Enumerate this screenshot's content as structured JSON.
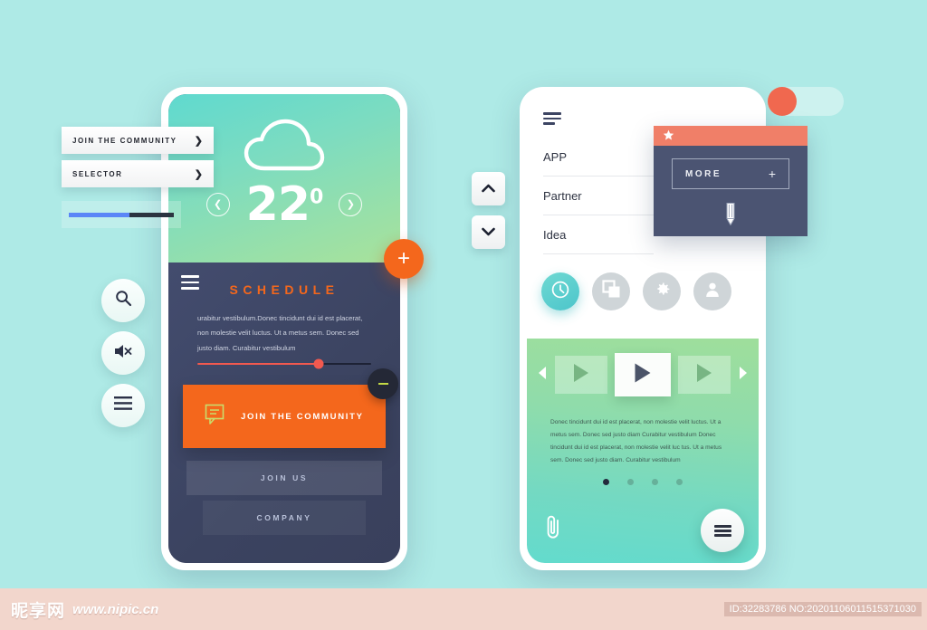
{
  "background": {
    "color": "#aeeae6"
  },
  "left_floating": {
    "buttons": [
      {
        "label": "JOIN THE COMMUNITY",
        "chevron": "chevron-right-icon"
      },
      {
        "label": "SELECTOR",
        "chevron": "chevron-right-icon"
      }
    ],
    "progress": {
      "fill_percent": 58,
      "fill_color": "#5b86f7",
      "track_color": "#2b3440"
    },
    "circle_buttons": [
      {
        "icon": "search-icon"
      },
      {
        "icon": "mute-speaker-icon"
      },
      {
        "icon": "hamburger-menu-icon"
      }
    ]
  },
  "left_phone": {
    "weather": {
      "icon": "cloud-icon",
      "temperature": "22",
      "degree_symbol": "0",
      "prev_icon": "chevron-left-icon",
      "next_icon": "chevron-right-icon"
    },
    "menu_icon": "hamburger-menu-icon",
    "schedule": {
      "title": "SCHEDULE",
      "title_color": "#f4671c",
      "body": "urabitur vestibulum.Donec tincidunt dui id est placerat, non molestie velit luctus. Ut a metus sem. Donec sed justo diam. Curabitur vestibulum",
      "slider": {
        "fill_percent": 70,
        "color": "#f2594f"
      },
      "cta": {
        "label": "JOIN THE COMMUNITY",
        "icon": "chat-bubble-icon",
        "color": "#f4671c"
      },
      "minus_button": {
        "icon": "minus-icon"
      },
      "stacked_buttons": [
        "JOIN US",
        "COMPANY"
      ]
    },
    "plus_fab": {
      "icon": "plus-icon",
      "color": "#f4671c"
    }
  },
  "mid_controls": {
    "up": {
      "icon": "chevron-up-icon"
    },
    "down": {
      "icon": "chevron-down-icon"
    }
  },
  "right_phone": {
    "menu_icon": "hamburger-menu-icon",
    "menu_items": [
      "APP",
      "Partner",
      "Idea"
    ],
    "icon_row": [
      {
        "icon": "clock-icon",
        "active": true
      },
      {
        "icon": "copy-layers-icon",
        "active": false
      },
      {
        "icon": "gear-icon",
        "active": false
      },
      {
        "icon": "user-icon",
        "active": false
      }
    ],
    "player": {
      "prev_icon": "triangle-left-icon",
      "next_icon": "triangle-right-icon",
      "cards": [
        {
          "icon": "play-icon",
          "active": false
        },
        {
          "icon": "play-icon",
          "active": true
        },
        {
          "icon": "play-icon",
          "active": false
        }
      ]
    },
    "paragraph": "Donec tincidunt dui id est placerat, non molestie velit luctus. Ut a metus sem. Donec sed justo diam Curabitur vestibulum Donec tincidunt dui id est placerat, non molestie velit luc tus. Ut a metus sem. Donec sed justo diam. Curabitur vestibulum",
    "pagination": {
      "count": 4,
      "active_index": 0
    },
    "clip_icon": "paperclip-icon",
    "fab": {
      "icon": "hamburger-menu-icon"
    }
  },
  "more_card": {
    "star_icon": "star-icon",
    "header_color": "#f07f68",
    "body_color": "#4b5472",
    "button_label": "MORE",
    "button_plus": "+",
    "pencil_icon": "pencil-icon"
  },
  "toggle": {
    "state": "off",
    "knob_color": "#f0684f"
  },
  "footer": {
    "logo": "昵享网",
    "url": "www.nipic.cn",
    "id_text": "ID:32283786 NO:20201106011515371030"
  }
}
